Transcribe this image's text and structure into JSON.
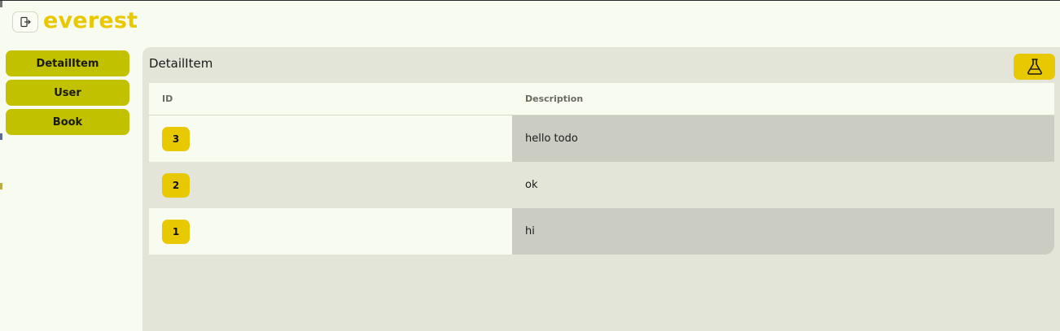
{
  "app": {
    "brand": "everest"
  },
  "sidebar": {
    "items": [
      {
        "label": "DetailItem"
      },
      {
        "label": "User"
      },
      {
        "label": "Book"
      }
    ]
  },
  "main": {
    "title": "DetailItem",
    "action_icon": "flask-icon",
    "table": {
      "headers": [
        "ID",
        "Description"
      ],
      "rows": [
        {
          "id": "3",
          "description": "hello todo"
        },
        {
          "id": "2",
          "description": "ok"
        },
        {
          "id": "1",
          "description": "hi"
        }
      ]
    }
  },
  "colors": {
    "accent": "#e8c800",
    "sidebar_button": "#c2c100",
    "page_bg": "#f8fbef",
    "panel_bg": "#e2e5d8",
    "row_highlight": "#cbcdc3"
  }
}
